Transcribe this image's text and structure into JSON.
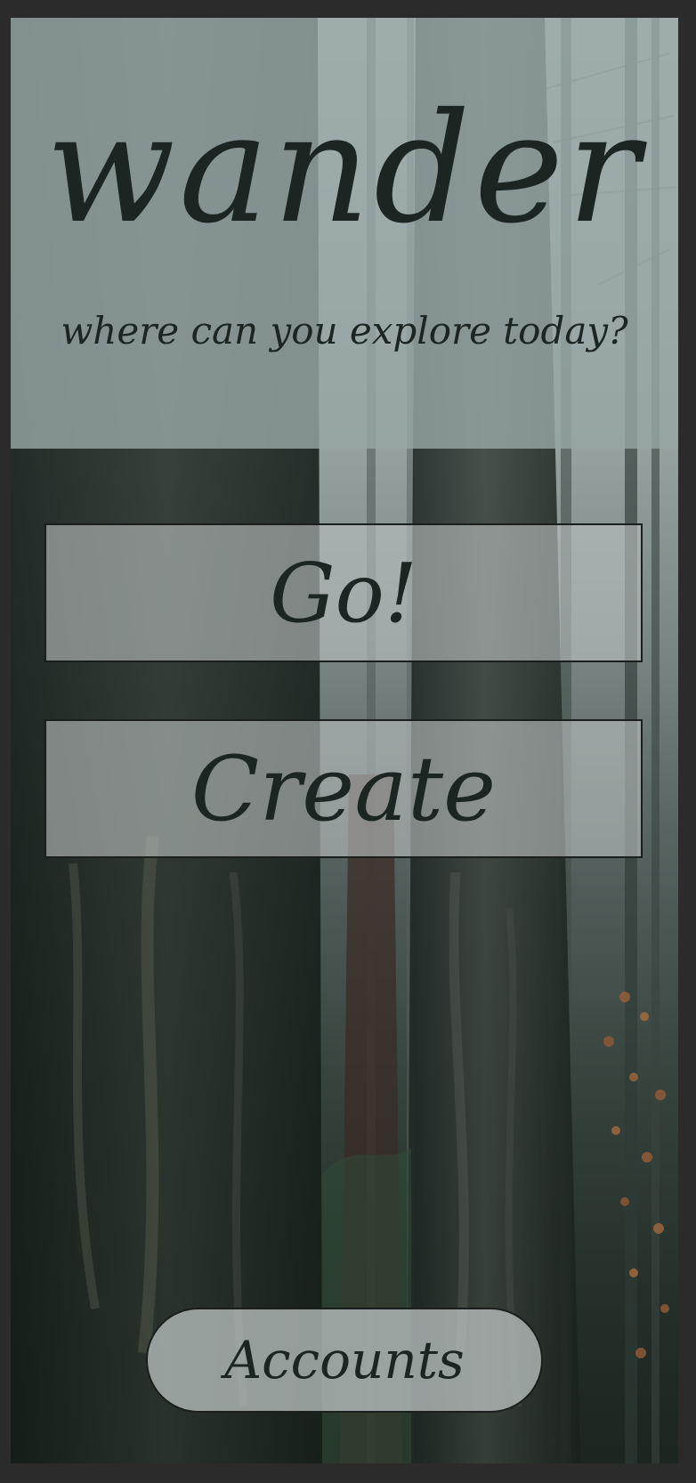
{
  "app": {
    "title": "wander",
    "subtitle": "where can you explore today?"
  },
  "buttons": {
    "go_label": "Go!",
    "create_label": "Create",
    "accounts_label": "Accounts"
  },
  "colors": {
    "frame": "#2b2b2b",
    "text": "#1b2522",
    "header_overlay": "#96a6a5",
    "button_fill": "#b9c0bf",
    "button_border": "#1a1f1d",
    "forest_dark": "#1c2520",
    "foliage_accent": "#a0603a"
  },
  "background": {
    "image_subject": "foggy forest with tall tree trunks"
  }
}
